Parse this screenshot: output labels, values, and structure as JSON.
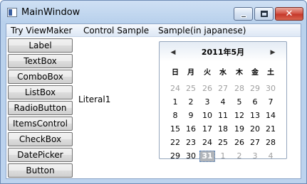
{
  "window": {
    "title": "MainWindow",
    "icon": "app-window-icon",
    "controls": {
      "close_label": "✕"
    }
  },
  "menu": {
    "items": [
      {
        "label": "Try ViewMaker"
      },
      {
        "label": "Control Sample"
      },
      {
        "label": "Sample(in japanese)"
      }
    ]
  },
  "sidebar": {
    "buttons": [
      {
        "label": "Label"
      },
      {
        "label": "TextBox"
      },
      {
        "label": "ComboBox"
      },
      {
        "label": "ListBox"
      },
      {
        "label": "RadioButton"
      },
      {
        "label": "ItemsControl"
      },
      {
        "label": "CheckBox"
      },
      {
        "label": "DatePicker"
      },
      {
        "label": "Button"
      }
    ]
  },
  "content": {
    "text": "Literal1"
  },
  "calendar": {
    "prev_glyph": "◀",
    "next_glyph": "▶",
    "title": "2011年5月",
    "weekdays": [
      "日",
      "月",
      "火",
      "水",
      "木",
      "金",
      "土"
    ],
    "weeks": [
      [
        {
          "d": "24",
          "m": true
        },
        {
          "d": "25",
          "m": true
        },
        {
          "d": "26",
          "m": true
        },
        {
          "d": "27",
          "m": true
        },
        {
          "d": "28",
          "m": true
        },
        {
          "d": "29",
          "m": true
        },
        {
          "d": "30",
          "m": true
        }
      ],
      [
        {
          "d": "1"
        },
        {
          "d": "2"
        },
        {
          "d": "3"
        },
        {
          "d": "4"
        },
        {
          "d": "5"
        },
        {
          "d": "6"
        },
        {
          "d": "7"
        }
      ],
      [
        {
          "d": "8"
        },
        {
          "d": "9"
        },
        {
          "d": "10"
        },
        {
          "d": "11"
        },
        {
          "d": "12"
        },
        {
          "d": "13"
        },
        {
          "d": "14"
        }
      ],
      [
        {
          "d": "15"
        },
        {
          "d": "16"
        },
        {
          "d": "17"
        },
        {
          "d": "18"
        },
        {
          "d": "19"
        },
        {
          "d": "20"
        },
        {
          "d": "21"
        }
      ],
      [
        {
          "d": "22"
        },
        {
          "d": "23"
        },
        {
          "d": "24"
        },
        {
          "d": "25"
        },
        {
          "d": "26"
        },
        {
          "d": "27"
        },
        {
          "d": "28"
        }
      ],
      [
        {
          "d": "29"
        },
        {
          "d": "30"
        },
        {
          "d": "31",
          "today": true
        },
        {
          "d": "1",
          "m": true
        },
        {
          "d": "2",
          "m": true
        },
        {
          "d": "3",
          "m": true
        },
        {
          "d": "4",
          "m": true
        }
      ]
    ]
  }
}
